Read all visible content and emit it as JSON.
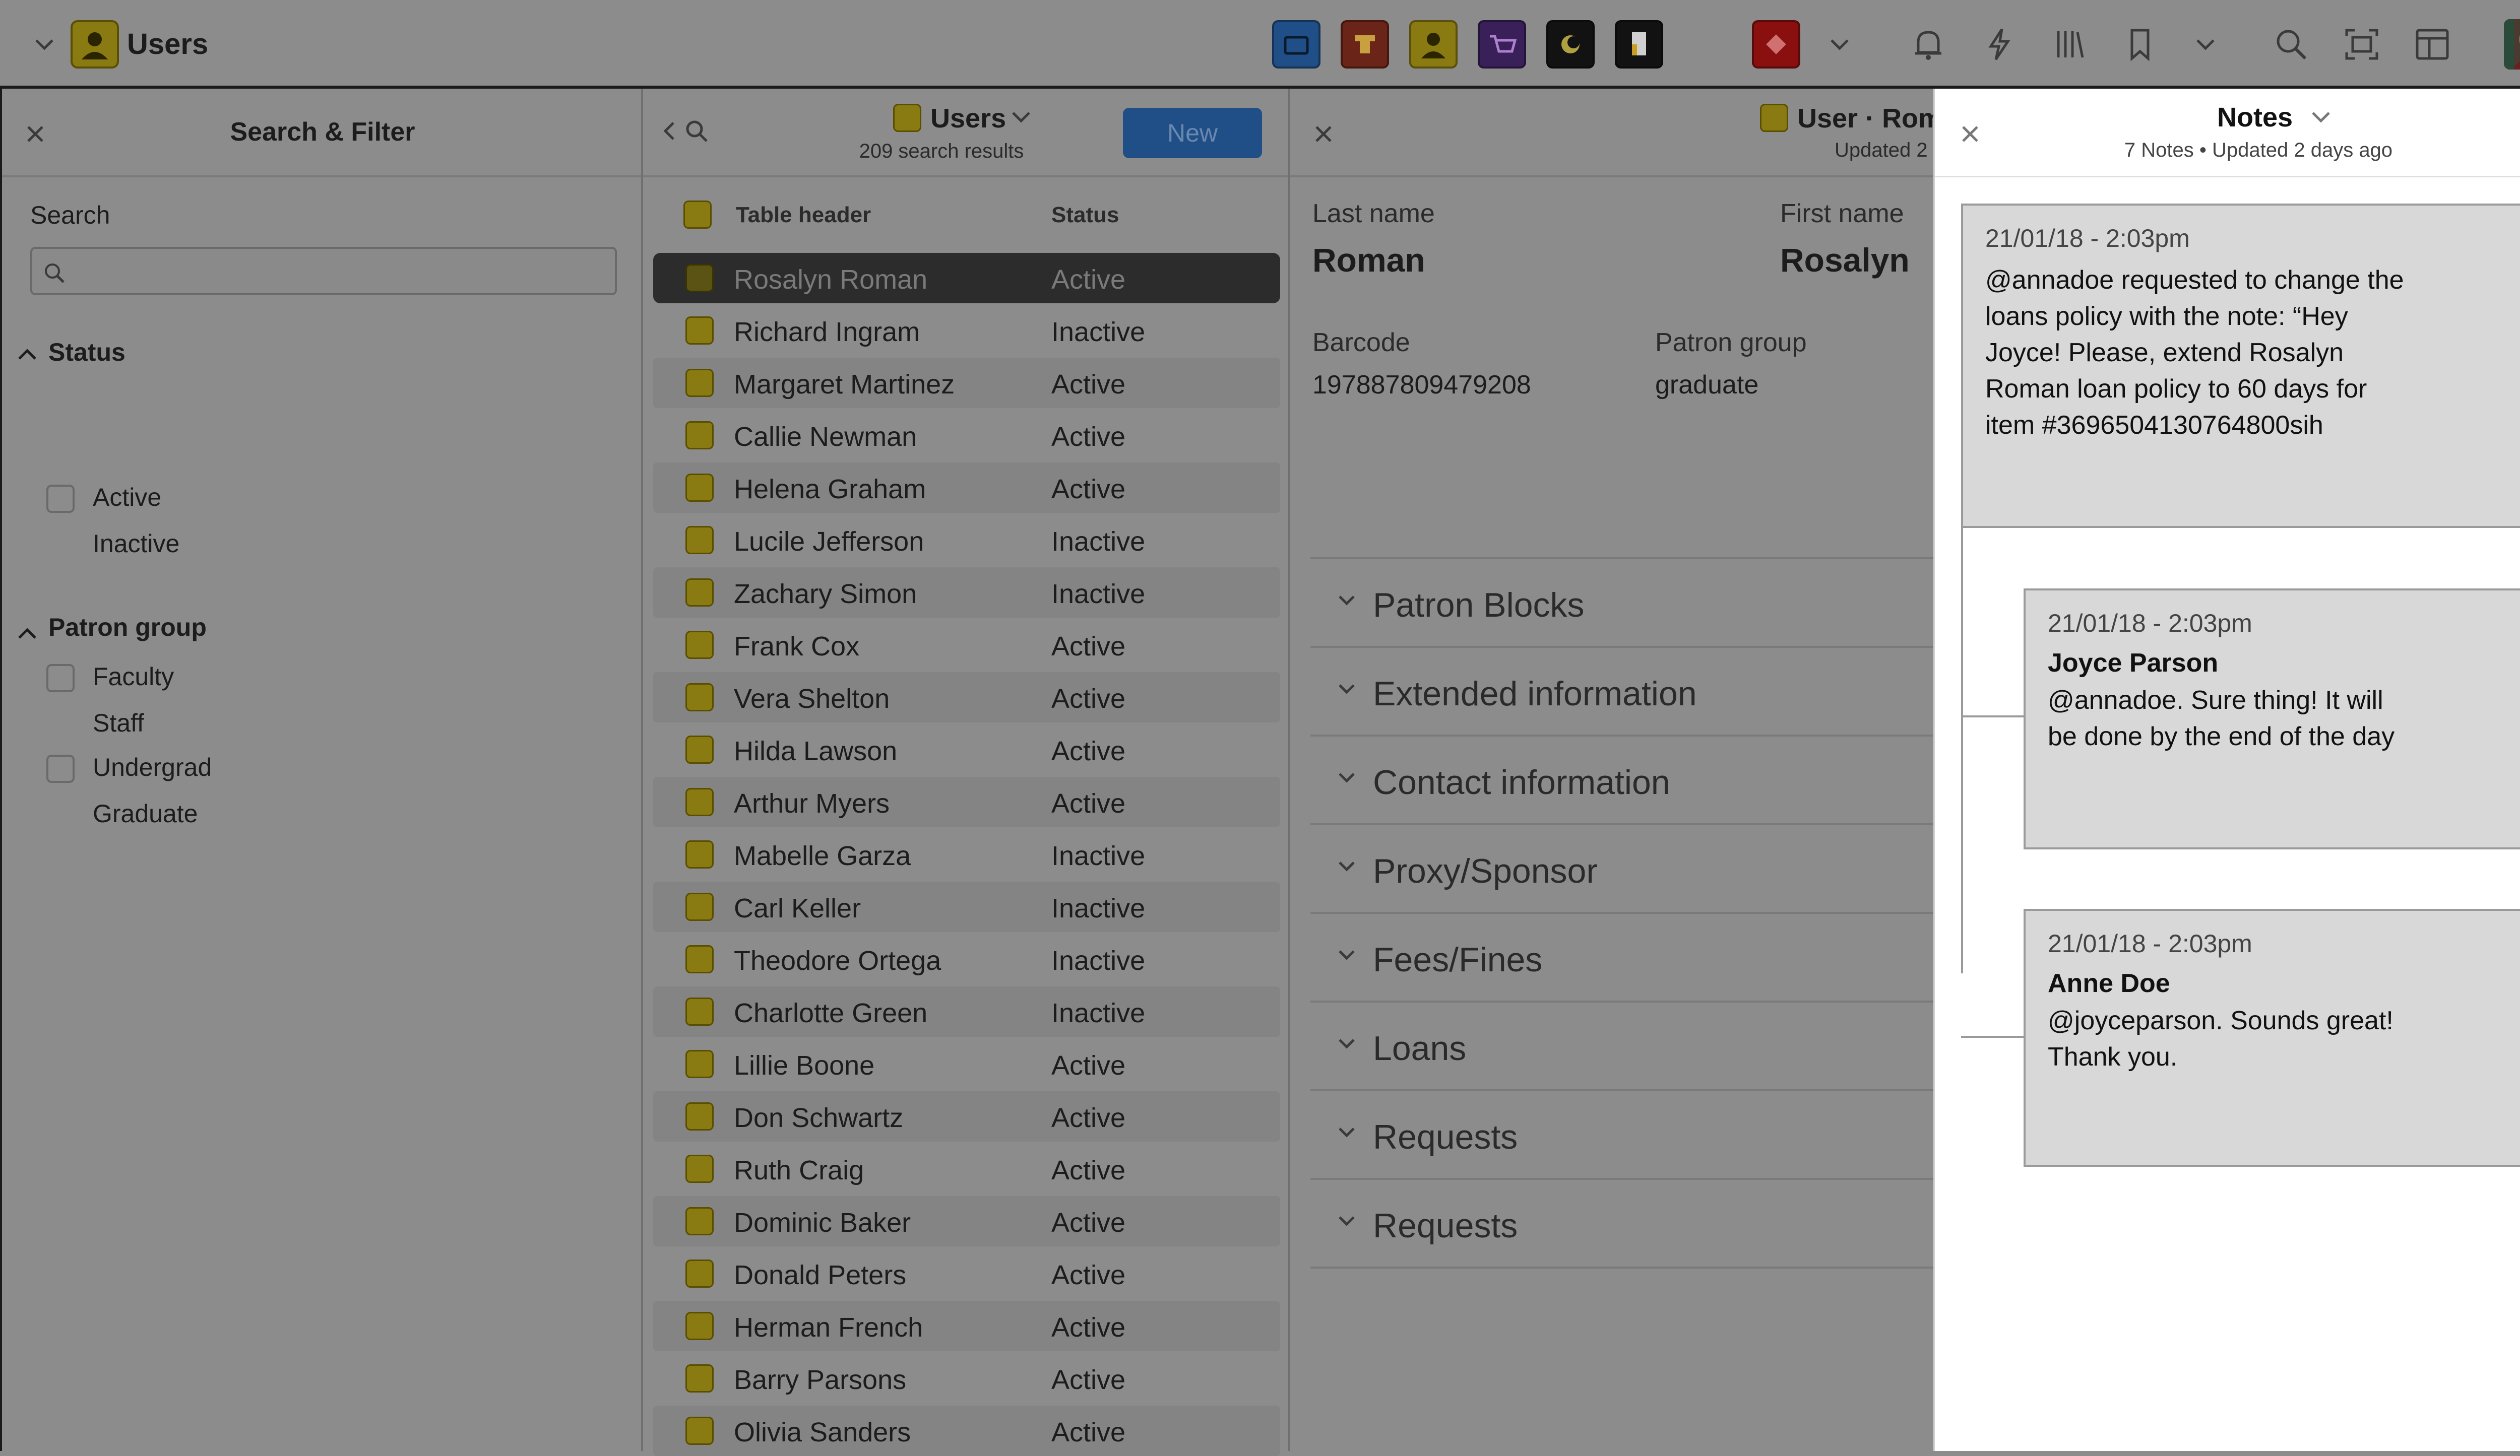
{
  "app": {
    "title": "Users"
  },
  "filter": {
    "title": "Search & Filter",
    "search_label": "Search",
    "search_placeholder": "",
    "status_heading": "Status",
    "status_options": [
      "Active",
      "Inactive"
    ],
    "patron_heading": "Patron group",
    "patron_options": [
      "Faculty",
      "Staff",
      "Undergrad",
      "Graduate"
    ]
  },
  "results": {
    "title": "Users",
    "subtitle": "209 search results",
    "new_button": "New",
    "col_name": "Table header",
    "col_status": "Status",
    "rows": [
      {
        "name": "Rosalyn Roman",
        "status": "Active"
      },
      {
        "name": "Richard Ingram",
        "status": "Inactive"
      },
      {
        "name": "Margaret Martinez",
        "status": "Active"
      },
      {
        "name": "Callie Newman",
        "status": "Active"
      },
      {
        "name": "Helena Graham",
        "status": "Active"
      },
      {
        "name": "Lucile Jefferson",
        "status": "Inactive"
      },
      {
        "name": "Zachary Simon",
        "status": "Inactive"
      },
      {
        "name": "Frank Cox",
        "status": "Active"
      },
      {
        "name": "Vera Shelton",
        "status": "Active"
      },
      {
        "name": "Hilda Lawson",
        "status": "Active"
      },
      {
        "name": "Arthur Myers",
        "status": "Active"
      },
      {
        "name": "Mabelle Garza",
        "status": "Inactive"
      },
      {
        "name": "Carl Keller",
        "status": "Inactive"
      },
      {
        "name": "Theodore Ortega",
        "status": "Inactive"
      },
      {
        "name": "Charlotte Green",
        "status": "Inactive"
      },
      {
        "name": "Lillie Boone",
        "status": "Active"
      },
      {
        "name": "Don Schwartz",
        "status": "Active"
      },
      {
        "name": "Ruth Craig",
        "status": "Active"
      },
      {
        "name": "Dominic Baker",
        "status": "Active"
      },
      {
        "name": "Donald Peters",
        "status": "Active"
      },
      {
        "name": "Herman French",
        "status": "Active"
      },
      {
        "name": "Barry Parsons",
        "status": "Active"
      },
      {
        "name": "Olivia Sanders",
        "status": "Active"
      }
    ]
  },
  "detail": {
    "title": "User · Rom",
    "subtitle": "Updated 2",
    "last_name_label": "Last name",
    "last_name": "Roman",
    "first_name_label": "First name",
    "first_name": "Rosalyn",
    "barcode_label": "Barcode",
    "barcode": "197887809479208",
    "patron_group_label": "Patron group",
    "patron_group": "graduate",
    "sections": [
      "Patron Blocks",
      "Extended information",
      "Contact information",
      "Proxy/Sponsor",
      "Fees/Fines",
      "Loans",
      "Requests",
      "Requests"
    ]
  },
  "notes": {
    "title": "Notes",
    "subtitle": "7 Notes • Updated 2 days ago",
    "items": [
      {
        "date": "21/01/18 - 2:03pm",
        "author": "",
        "body": "@annadoe requested to change the\nloans policy with the note: “Hey\nJoyce! Please, extend Rosalyn\nRoman loan policy to 60 days for\nitem #3696504130764800sih"
      },
      {
        "date": "21/01/18 - 2:03pm",
        "author": "Joyce Parson",
        "body": "@annadoe. Sure thing! It will\nbe done by the end of the day"
      },
      {
        "date": "21/01/18 - 2:03pm",
        "author": "Anne Doe",
        "body": "@joyceparson. Sounds great!\nThank you."
      }
    ]
  },
  "colors": {
    "accent_blue": "#1f4f86",
    "user_yellow": "#8a7a12",
    "overlay_gray": "#8c8c8c"
  }
}
